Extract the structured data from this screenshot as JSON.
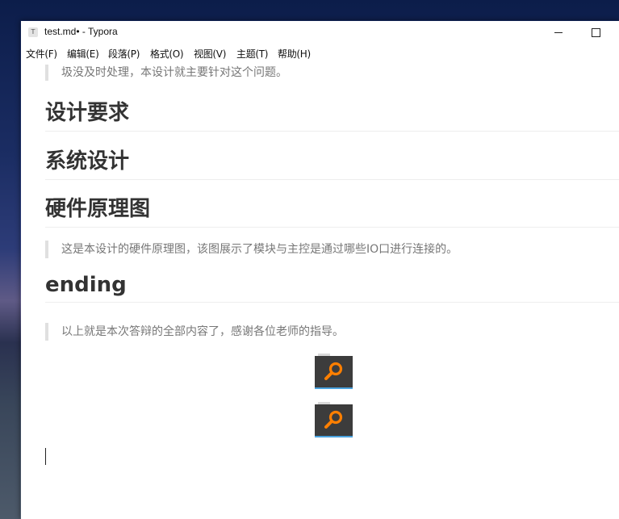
{
  "window": {
    "app_icon_letter": "T",
    "title": "test.md• - Typora"
  },
  "menu": [
    "文件(F)",
    "编辑(E)",
    "段落(P)",
    "格式(O)",
    "视图(V)",
    "主题(T)",
    "帮助(H)"
  ],
  "document": {
    "intro_tail": "圾没及时处理，本设计就主要针对这个问题。",
    "headings": [
      "设计要求",
      "系统设计",
      "硬件原理图",
      "ending"
    ],
    "hardware_note": "这是本设计的硬件原理图，该图展示了模块与主控是通过哪些IO口进行连接的。",
    "closing": "以上就是本次答辩的全部内容了，感谢各位老师的指导。"
  },
  "colors": {
    "heading": "#333333",
    "quote_text": "#777777",
    "quote_bar": "#e0e0e0",
    "image_tile": "#3c3c3c",
    "image_icon": "#ff7f00"
  },
  "icons": [
    "app-icon",
    "minimize-icon",
    "maximize-icon",
    "search-magnifier-icon"
  ]
}
